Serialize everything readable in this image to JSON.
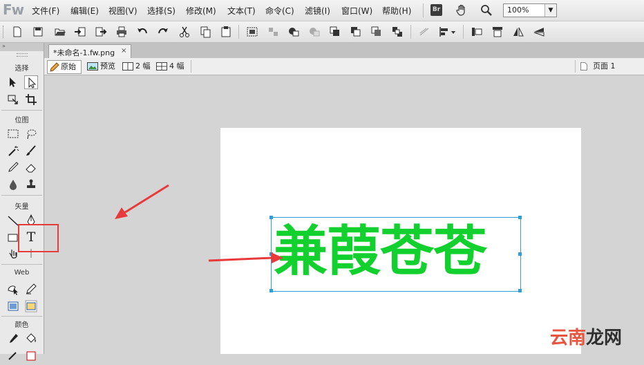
{
  "app": {
    "logo": "Fw",
    "menu": [
      "文件(F)",
      "编辑(E)",
      "视图(V)",
      "选择(S)",
      "修改(M)",
      "文本(T)",
      "命令(C)",
      "滤镜(I)",
      "窗口(W)",
      "帮助(H)"
    ],
    "bridge_label": "Br",
    "zoom": "100%"
  },
  "tools_panel": {
    "sections": {
      "select": "选择",
      "bitmap": "位图",
      "vector": "矢量",
      "web": "Web",
      "color": "颜色"
    },
    "text_tool_glyph": "T"
  },
  "document": {
    "tab_label": "*未命名-1.fw.png",
    "tab_close": "×",
    "views": {
      "original": "原始",
      "preview": "预览",
      "two_up": "2 幅",
      "four_up": "4 幅"
    },
    "page_label": "页面 1"
  },
  "canvas": {
    "text": "兼葭苍苍",
    "text_color": "#12d12e",
    "selection_color": "#2e9fdc"
  },
  "annotation": {
    "arrow_color": "#e83a3a"
  },
  "watermark": {
    "part1": "云南",
    "part2": "龙网"
  }
}
